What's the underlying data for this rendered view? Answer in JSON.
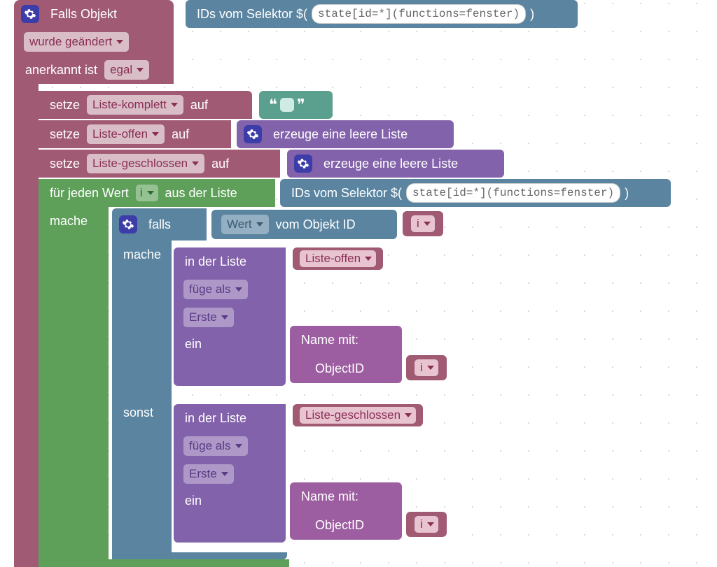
{
  "trigger": {
    "falls_objekt": "Falls Objekt",
    "ids_label": "IDs vom Selektor $(",
    "selector": "state[id=*](functions=fenster)",
    "close_paren": ")",
    "condition_dd": "wurde geändert",
    "ack_label": "anerkannt ist",
    "ack_value": "egal"
  },
  "sets": {
    "setze": "setze",
    "auf": "auf",
    "list_komplett": "Liste-komplett",
    "list_offen": "Liste-offen",
    "list_geschlossen": "Liste-geschlossen",
    "leere_liste": "erzeuge eine leere Liste"
  },
  "loop": {
    "for_each": "für jeden Wert",
    "var": "i",
    "aus_liste": "aus der Liste",
    "ids_label": "IDs vom Selektor $(",
    "selector": "state[id=*](functions=fenster)",
    "close_paren": ")",
    "mache": "mache"
  },
  "inner_if": {
    "falls": "falls",
    "wert": "Wert",
    "vom_objekt": "vom Objekt ID",
    "var": "i",
    "mache": "mache",
    "sonst": "sonst"
  },
  "list_op": {
    "in_liste": "in der Liste",
    "fuge_als": "füge als",
    "erste": "Erste",
    "ein": "ein",
    "name_mit": "Name  mit:",
    "object_id": "ObjectID",
    "var": "i",
    "target_offen": "Liste-offen",
    "target_geschlossen": "Liste-geschlossen"
  }
}
